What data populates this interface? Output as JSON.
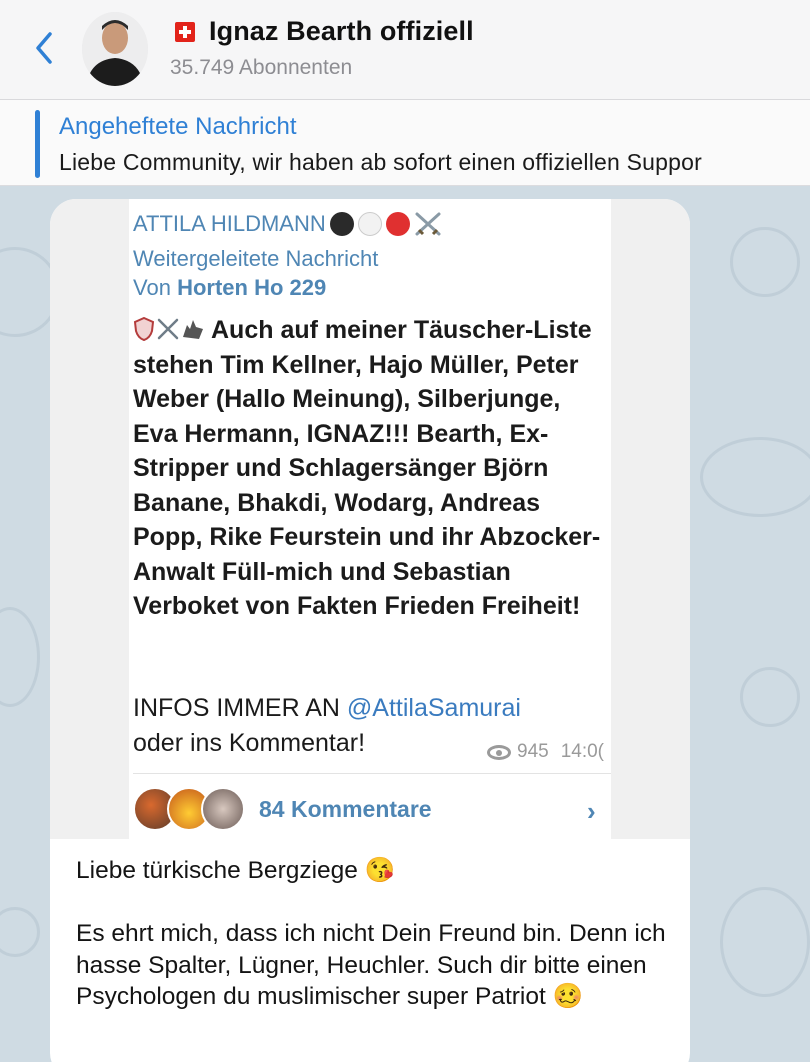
{
  "header": {
    "back_icon": "chevron-left-icon",
    "flag": "swiss-flag-icon",
    "channel_name": "Ignaz Bearth offiziell",
    "subscribers": "35.749 Abonnenten"
  },
  "pinned": {
    "title": "Angeheftete Nachricht",
    "text": "Liebe Community, wir haben ab sofort einen offiziellen Suppor"
  },
  "post": {
    "forwarded": {
      "channel": "ATTILA HILDMANN",
      "channel_emojis": [
        "black-circle",
        "white-circle",
        "red-circle",
        "crossed-swords"
      ],
      "label": "Weitergeleitete Nachricht",
      "from_prefix": "Von",
      "from_name": "Horten Ho 229",
      "body_icons": [
        "shield-icon",
        "crossed-swords-icon",
        "wolf-icon"
      ],
      "body": "Auch auf meiner Täuscher-Liste stehen Tim Kellner, Hajo Müller, Peter Weber (Hallo Meinung), Silberjunge, Eva Hermann, IGNAZ!!! Bearth, Ex-Stripper und Schlagersänger Björn Banane, Bhakdi, Wodarg, Andreas Popp, Rike Feurstein und ihr Abzocker-Anwalt Füll-mich und Sebastian Verboket von Fakten Frieden Freiheit!",
      "info_prefix": "INFOS IMMER AN",
      "info_mention": "@AttilaSamurai",
      "info_suffix": "oder ins Kommentar!",
      "views": "945",
      "time": "14:0(",
      "comments_label": "84 Kommentare"
    },
    "message": "Liebe türkische Bergziege 😘\n\nEs ehrt mich, dass ich nicht Dein Freund bin. Denn ich hasse Spalter, Lügner, Heuchler. Such dir bitte einen Psychologen du muslimischer super Patriot 🥴"
  },
  "colors": {
    "accent": "#2f80d5",
    "link": "#4f86b4",
    "chat_bg": "#cfdbe3",
    "header_bg": "#f6f6f7"
  }
}
